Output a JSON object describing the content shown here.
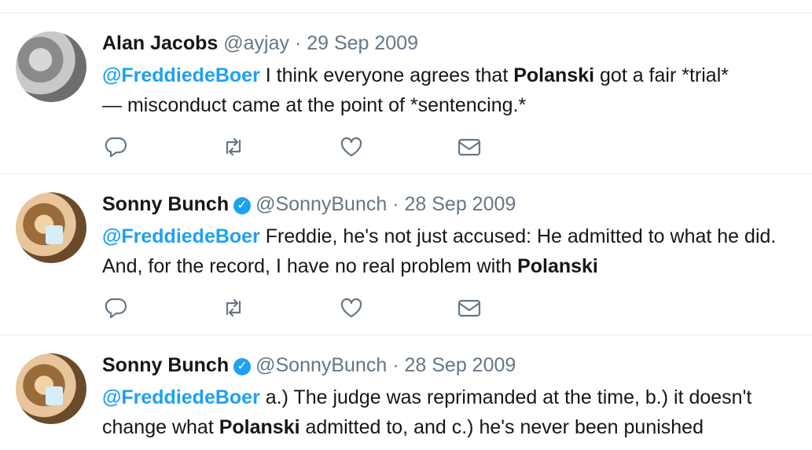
{
  "tweets": [
    {
      "name": "Alan Jacobs",
      "handle": "@ayjay",
      "date": "29 Sep 2009",
      "verified": false,
      "text_parts": [
        {
          "t": "mention",
          "v": "@FreddiedeBoer"
        },
        {
          "t": "plain",
          "v": " I think everyone agrees that "
        },
        {
          "t": "bold",
          "v": "Polanski"
        },
        {
          "t": "plain",
          "v": " got a fair *trial*"
        },
        {
          "t": "br"
        },
        {
          "t": "plain",
          "v": "— misconduct came at the point of *sentencing.*"
        }
      ]
    },
    {
      "name": "Sonny Bunch",
      "handle": "@SonnyBunch",
      "date": "28 Sep 2009",
      "verified": true,
      "text_parts": [
        {
          "t": "mention",
          "v": "@FreddiedeBoer"
        },
        {
          "t": "plain",
          "v": " Freddie, he's not just accused: He admitted to what he did."
        },
        {
          "t": "br"
        },
        {
          "t": "plain",
          "v": "And, for the record, I have no real problem with "
        },
        {
          "t": "bold",
          "v": "Polanski"
        }
      ]
    },
    {
      "name": "Sonny Bunch",
      "handle": "@SonnyBunch",
      "date": "28 Sep 2009",
      "verified": true,
      "text_parts": [
        {
          "t": "mention",
          "v": "@FreddiedeBoer"
        },
        {
          "t": "plain",
          "v": " a.) The judge was reprimanded at the time, b.) it doesn't"
        },
        {
          "t": "br"
        },
        {
          "t": "plain",
          "v": "change what "
        },
        {
          "t": "bold",
          "v": "Polanski"
        },
        {
          "t": "plain",
          "v": " admitted to, and c.) he's never been punished"
        }
      ]
    }
  ],
  "icons": {
    "reply": "reply-icon",
    "retweet": "retweet-icon",
    "like": "like-icon",
    "message": "direct-message-icon"
  },
  "colors": {
    "mention": "#1da1f2",
    "secondary_text": "#657786",
    "divider": "#e6ecf0",
    "icon": "#657786"
  }
}
